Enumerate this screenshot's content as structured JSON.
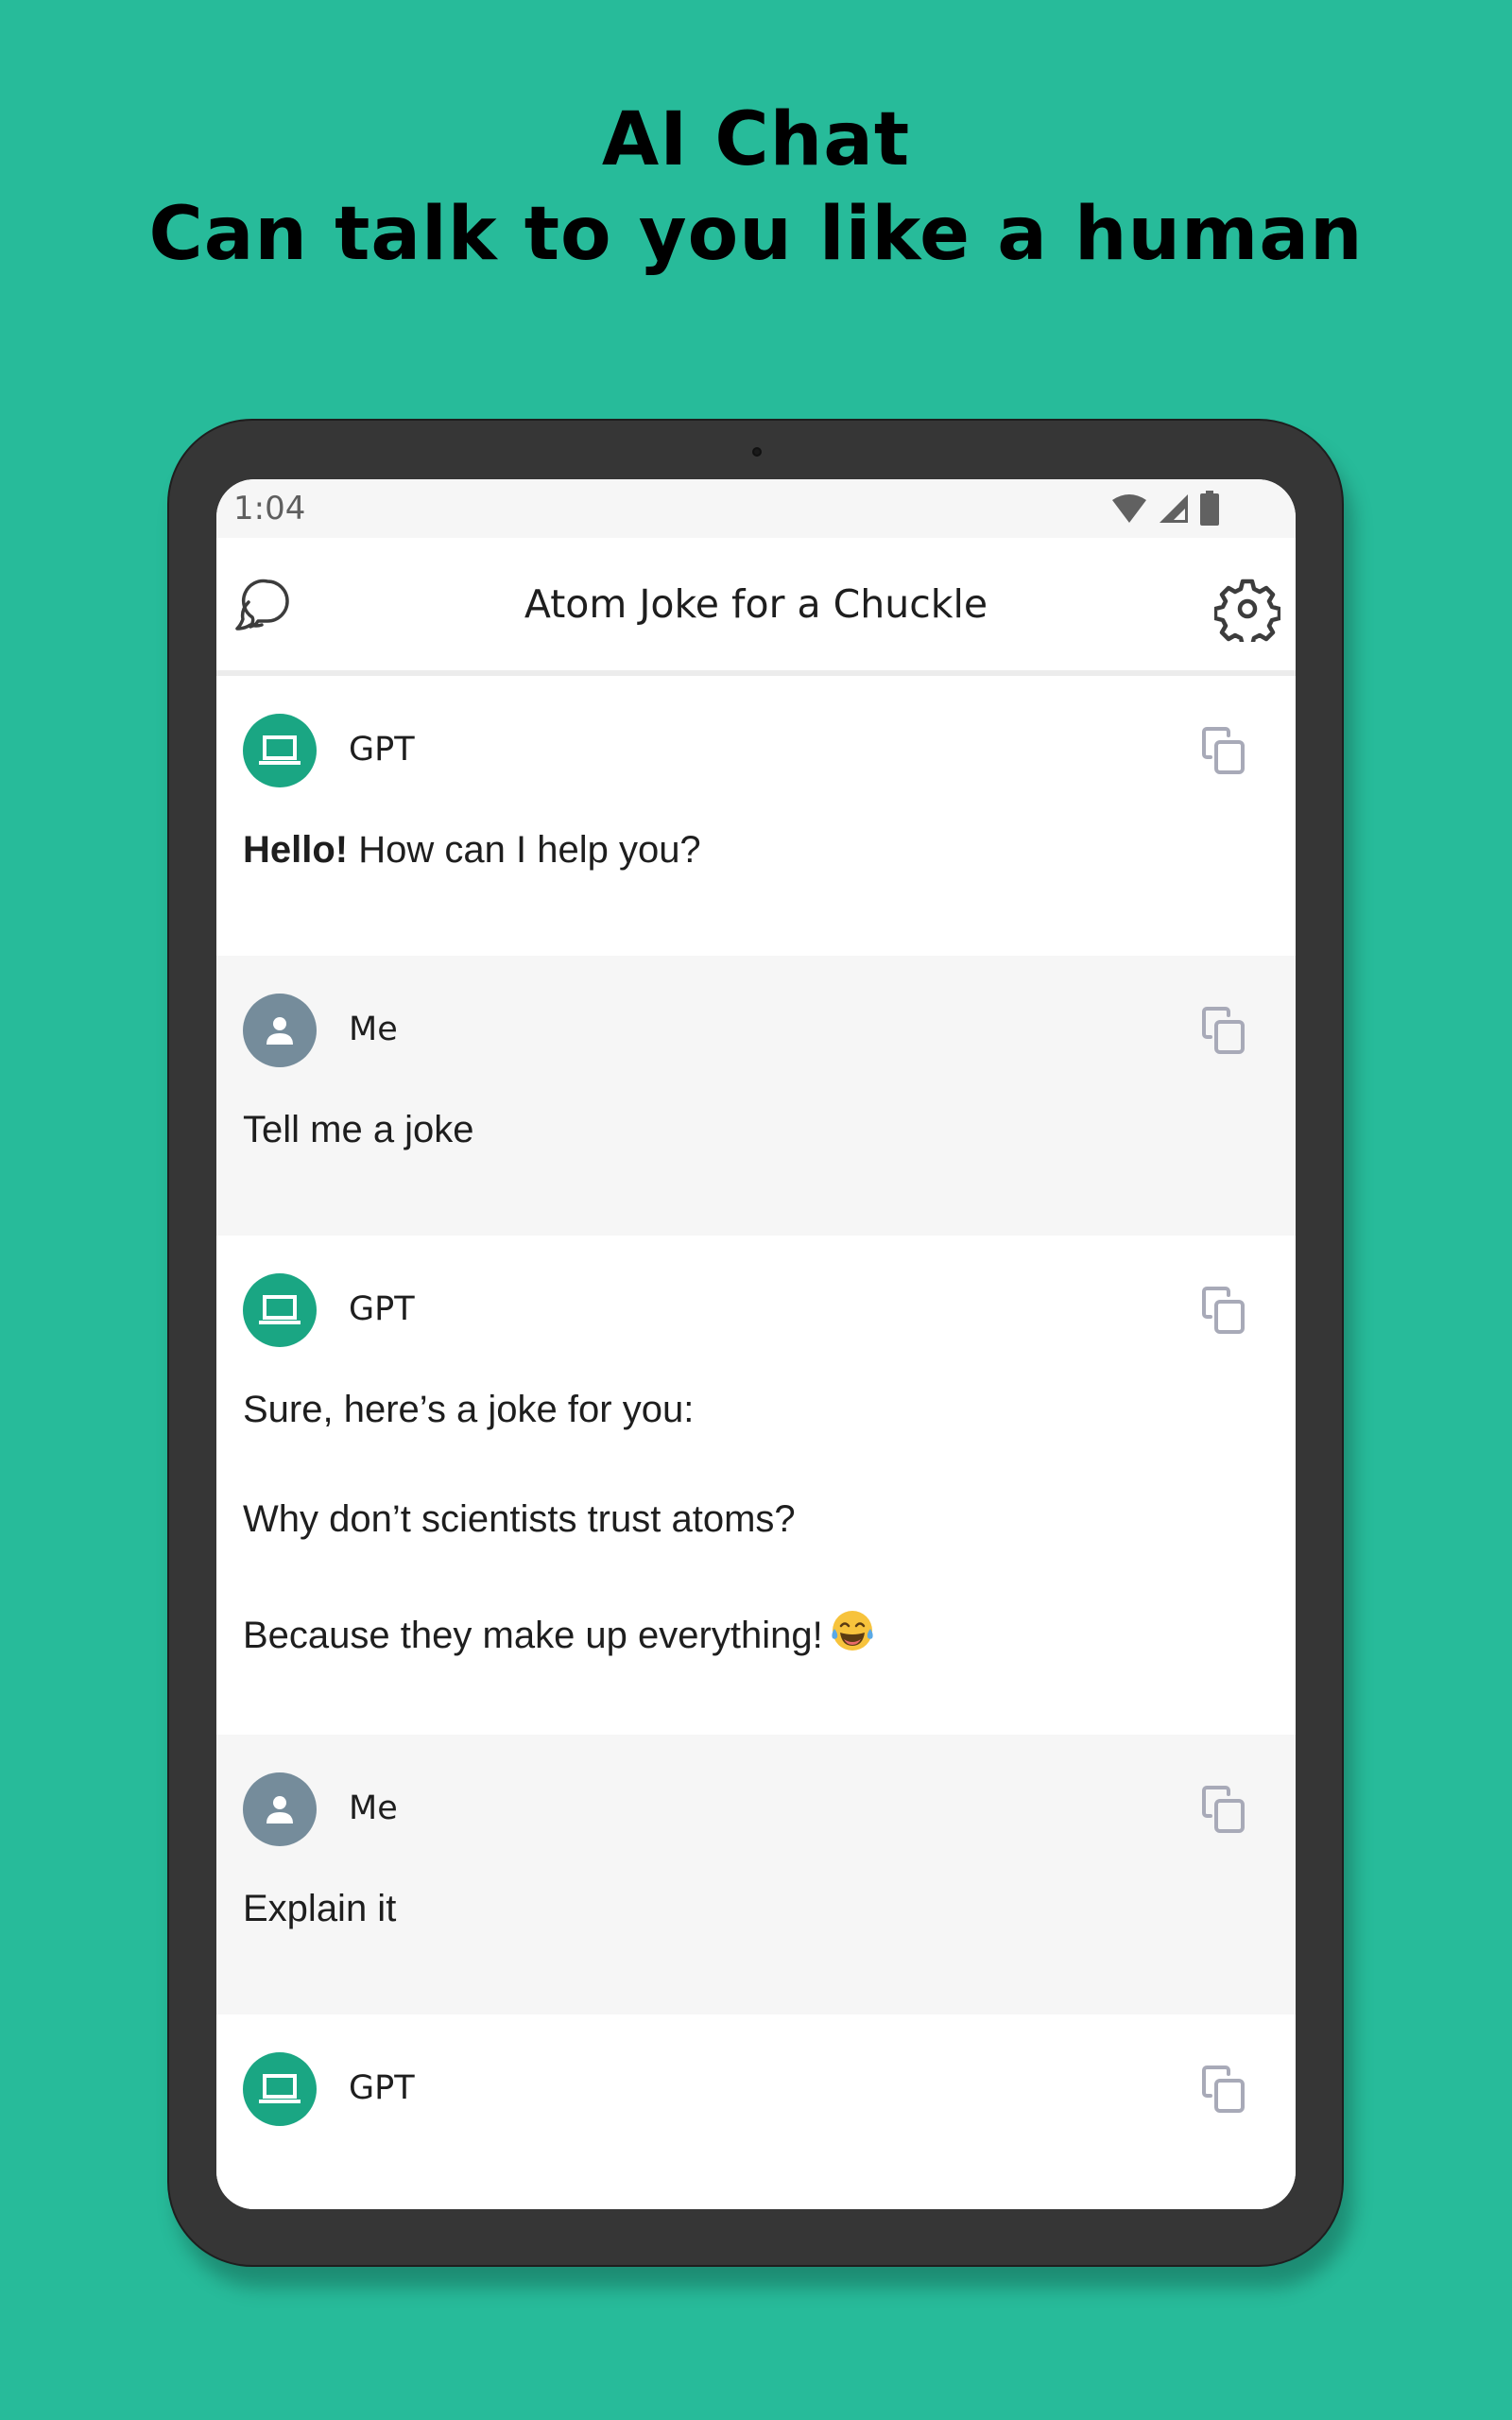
{
  "promo": {
    "headline_line1": "AI Chat",
    "headline_line2": "Can talk to you like a human",
    "background_color": "#27bb9a"
  },
  "status_bar": {
    "time": "1:04",
    "icons": [
      "wifi-icon",
      "cellular-signal-icon",
      "battery-icon"
    ]
  },
  "app_bar": {
    "title": "Atom Joke for a Chuckle",
    "left_icon": "chat-bubbles-icon",
    "right_icon": "gear-icon"
  },
  "messages": [
    {
      "role": "bot",
      "sender": "GPT",
      "avatar_icon": "laptop-icon",
      "paragraphs": [
        {
          "bold": "Hello!",
          "text": " How can I help you?"
        }
      ]
    },
    {
      "role": "user",
      "sender": "Me",
      "avatar_icon": "person-icon",
      "paragraphs": [
        {
          "bold": "",
          "text": "Tell me a joke"
        }
      ]
    },
    {
      "role": "bot",
      "sender": "GPT",
      "avatar_icon": "laptop-icon",
      "paragraphs": [
        {
          "bold": "",
          "text": "Sure, here’s a joke for you:"
        },
        {
          "bold": "",
          "text": "Why don’t scientists trust atoms?"
        },
        {
          "bold": "",
          "text": "Because they make up everything!",
          "emoji": "face-with-tears-of-joy-emoji"
        }
      ]
    },
    {
      "role": "user",
      "sender": "Me",
      "avatar_icon": "person-icon",
      "paragraphs": [
        {
          "bold": "",
          "text": "Explain it"
        }
      ]
    },
    {
      "role": "bot",
      "sender": "GPT",
      "avatar_icon": "laptop-icon",
      "paragraphs": []
    }
  ],
  "colors": {
    "bot_avatar": "#1aa683",
    "user_avatar": "#758c9b",
    "user_message_bg": "#f6f6f6",
    "copy_icon": "#a8aab8"
  }
}
